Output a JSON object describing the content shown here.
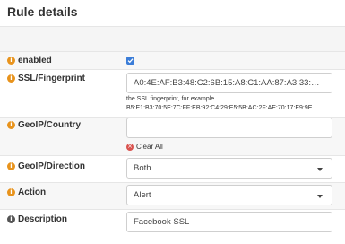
{
  "title": "Rule details",
  "fields": {
    "enabled": {
      "label": "enabled",
      "checked": true
    },
    "fingerprint": {
      "label": "SSL/Fingerprint",
      "value": "A0:4E:AF:B3:48:C2:6B:15:A8:C1:AA:87:A3:33:CA:A3:CD:…",
      "help_line1": "the SSL fingerprint, for example",
      "help_line2": "B5:E1:B3:70:5E:7C:FF:EB:92:C4:29:E5:5B:AC:2F:AE:70:17:E9:9E"
    },
    "geoip_country": {
      "label": "GeoIP/Country",
      "value": "",
      "clear_label": "Clear All"
    },
    "geoip_direction": {
      "label": "GeoIP/Direction",
      "value": "Both"
    },
    "action": {
      "label": "Action",
      "value": "Alert"
    },
    "description": {
      "label": "Description",
      "value": "Facebook SSL"
    }
  },
  "icons": {
    "info": "info-icon",
    "clear": "clear-icon",
    "caret": "chevron-down-icon",
    "check": "check-icon"
  },
  "colors": {
    "info": "#e8931c",
    "checkbox": "#3b7dd8",
    "clear": "#d9534f"
  }
}
